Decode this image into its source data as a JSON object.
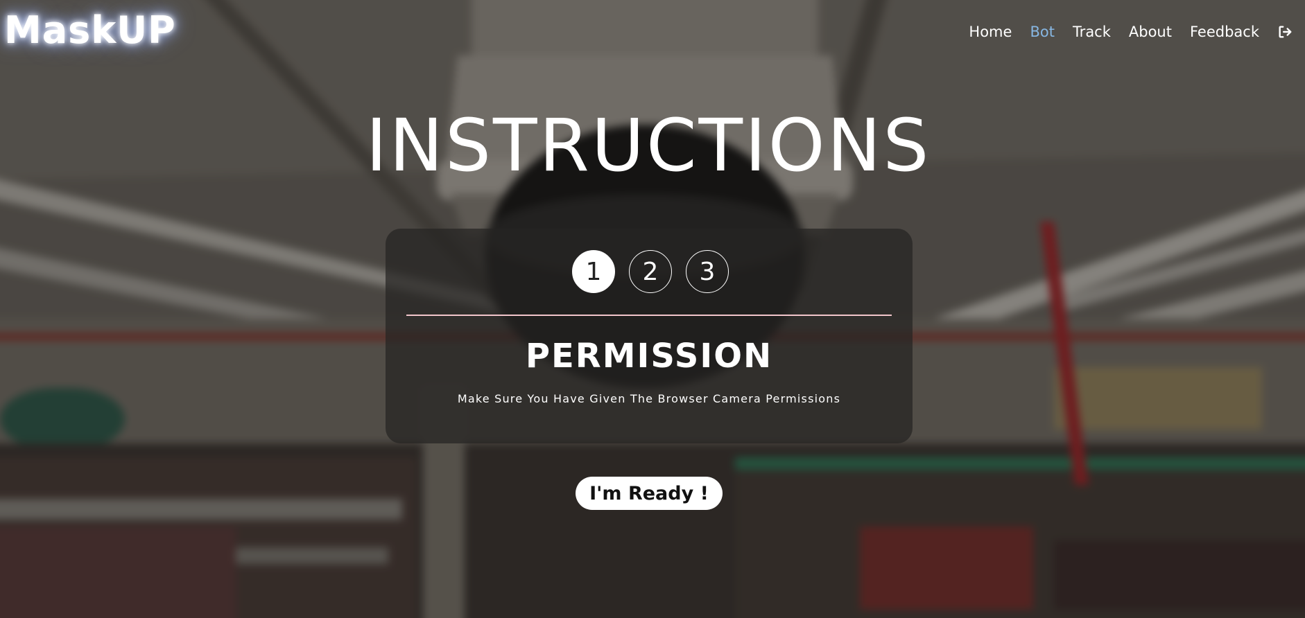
{
  "brand": {
    "name": "MaskUP"
  },
  "nav": {
    "items": [
      {
        "label": "Home",
        "active": false
      },
      {
        "label": "Bot",
        "active": true
      },
      {
        "label": "Track",
        "active": false
      },
      {
        "label": "About",
        "active": false
      },
      {
        "label": "Feedback",
        "active": false
      }
    ],
    "logout_icon": "logout-icon"
  },
  "main": {
    "title": "INSTRUCTIONS",
    "steps": [
      {
        "label": "1",
        "active": true
      },
      {
        "label": "2",
        "active": false
      },
      {
        "label": "3",
        "active": false
      }
    ],
    "current_step": {
      "heading": "PERMISSION",
      "description": "Make Sure You Have Given The Browser Camera Permissions"
    },
    "ready_button": "I'm Ready !"
  },
  "colors": {
    "active_nav": "#87b7e3",
    "divider": "#f3c6cc",
    "card_bg": "rgba(38,36,34,0.72)"
  }
}
